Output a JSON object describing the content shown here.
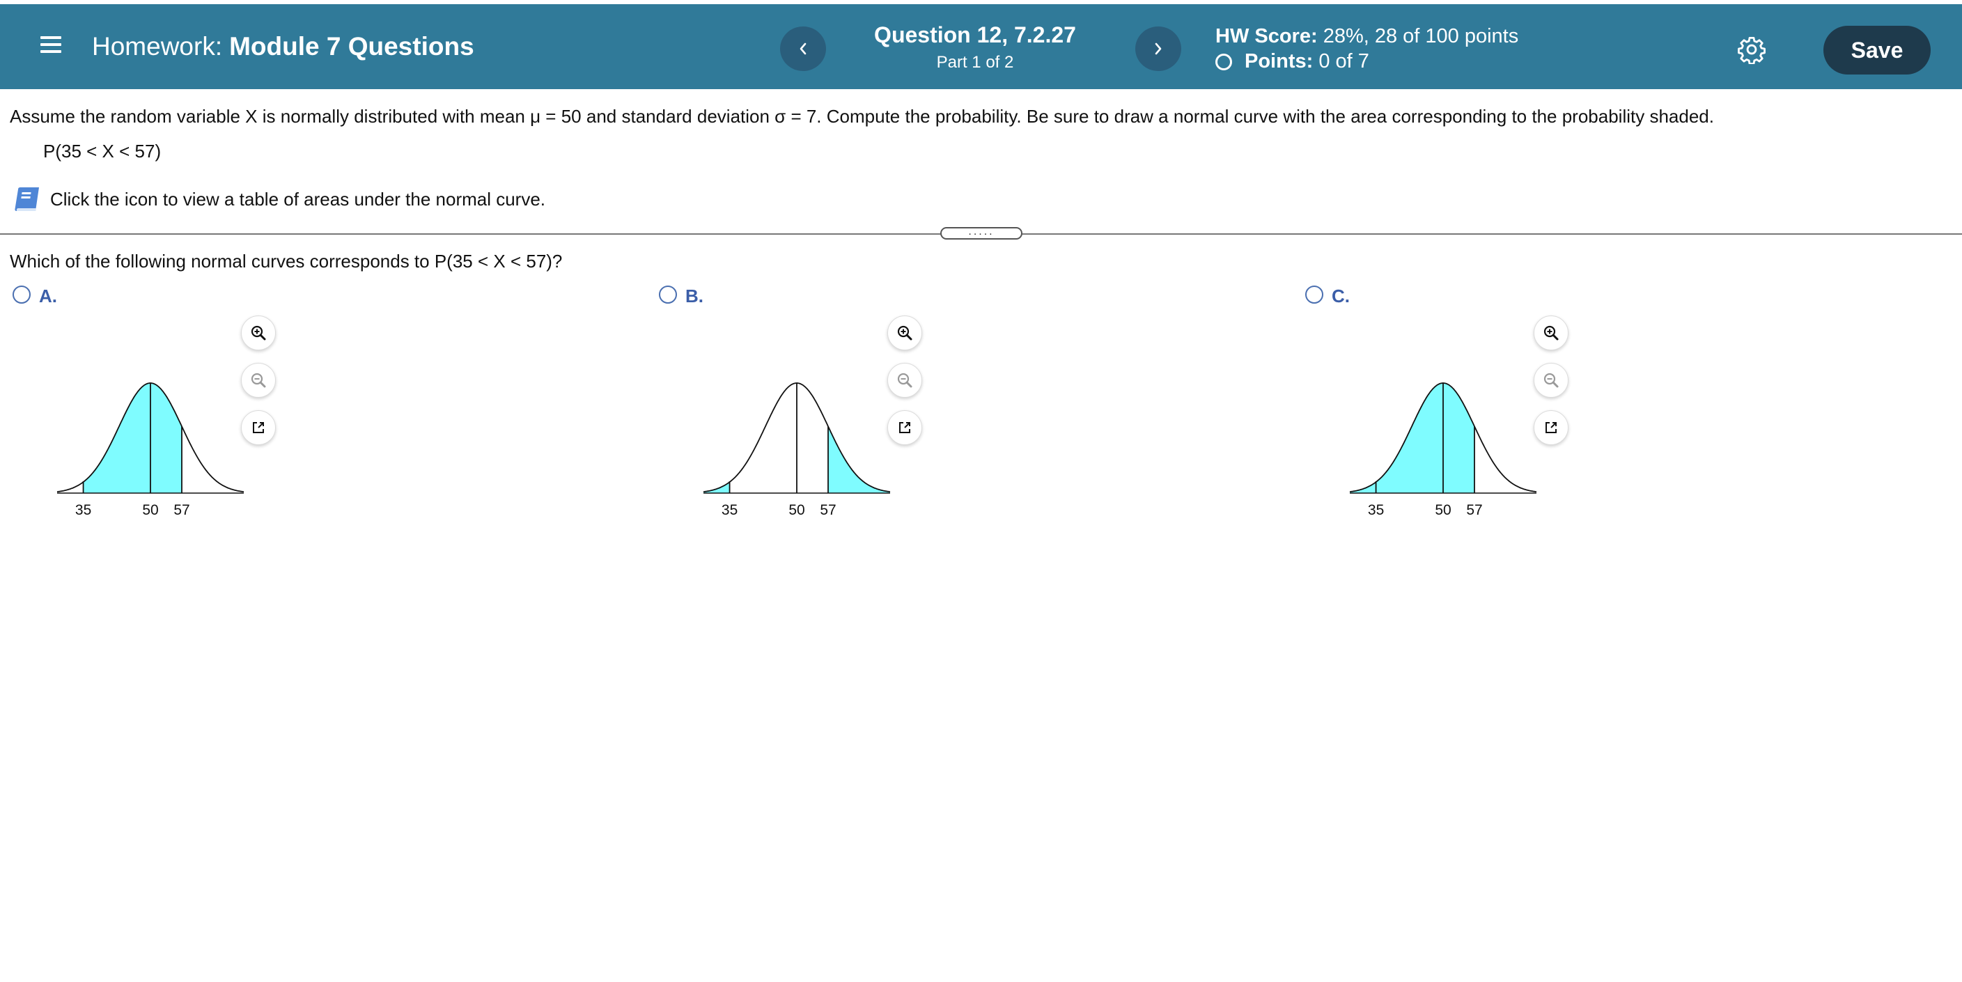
{
  "header": {
    "homework_prefix": "Homework:",
    "homework_name": "Module 7 Questions",
    "question_title": "Question 12, 7.2.27",
    "question_part": "Part 1 of 2",
    "hw_score_label": "HW Score:",
    "hw_score_value": "28%, 28 of 100 points",
    "points_label": "Points:",
    "points_value": "0 of 7",
    "save_label": "Save",
    "icons": [
      "menu-icon",
      "chevron-left-icon",
      "chevron-right-icon",
      "gear-icon"
    ]
  },
  "problem": {
    "statement": "Assume the random variable X is normally distributed with mean μ = 50 and standard deviation σ = 7. Compute the probability. Be sure to draw a normal curve with the area corresponding to the probability shaded.",
    "expression": "P(35 < X < 57)",
    "table_link_text": "Click the icon to view a table of areas under the normal curve.",
    "splitter_label": "....."
  },
  "sub_question": {
    "text": "Which of the following normal curves corresponds to P(35 < X < 57)?",
    "options": [
      {
        "label": "A.",
        "ticks": [
          "35",
          "50",
          "57"
        ],
        "shaded": "35 to 57",
        "selected": false
      },
      {
        "label": "B.",
        "ticks": [
          "35",
          "50",
          "57"
        ],
        "shaded": "below 35 and above 57",
        "selected": false
      },
      {
        "label": "C.",
        "ticks": [
          "35",
          "50",
          "57"
        ],
        "shaded": "below 57",
        "selected": false
      }
    ]
  },
  "colors": {
    "header_bg": "#307a99",
    "save_bg": "#1e3a4c",
    "shade_fill": "#7ffcff",
    "option_label": "#3b5ea8"
  }
}
